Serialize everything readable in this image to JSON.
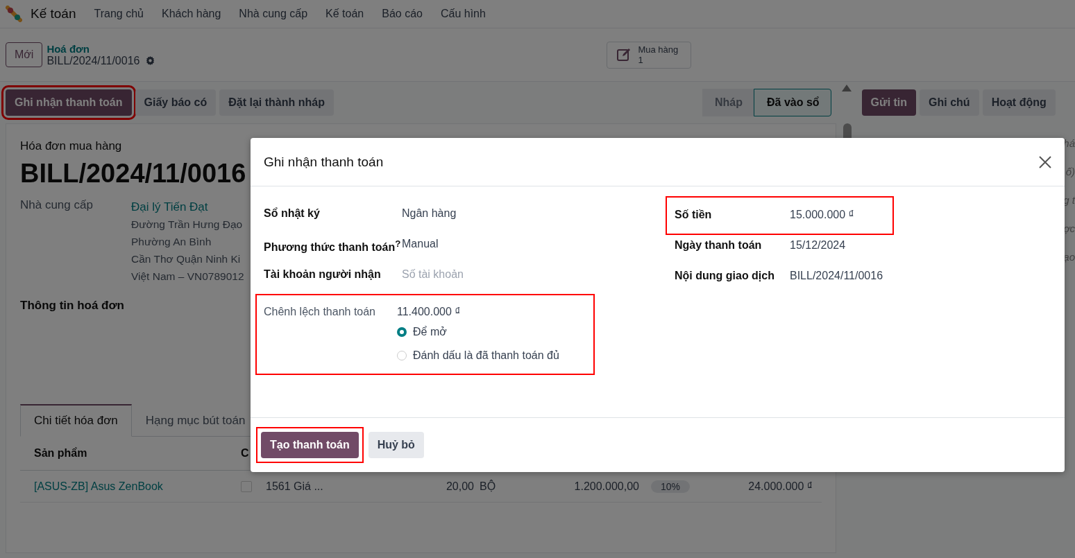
{
  "app": {
    "name": "Kế toán",
    "menu": [
      "Trang chủ",
      "Khách hàng",
      "Nhà cung cấp",
      "Kế toán",
      "Báo cáo",
      "Cấu hình"
    ]
  },
  "breadcrumb": {
    "new_button": "Mới",
    "parent": "Hoá đơn",
    "current": "BILL/2024/11/0016"
  },
  "smart_button": {
    "label": "Mua hàng",
    "count": "1"
  },
  "actions": [
    {
      "label": "Ghi nhận thanh toán",
      "primary": true,
      "highlighted": true
    },
    {
      "label": "Giấy báo có",
      "primary": false,
      "highlighted": false
    },
    {
      "label": "Đặt lại thành nháp",
      "primary": false,
      "highlighted": false
    }
  ],
  "statusbar": [
    {
      "label": "Nháp",
      "selected": false
    },
    {
      "label": "Đã vào sổ",
      "selected": true
    }
  ],
  "chatter": {
    "buttons": [
      {
        "label": "Gửi tin",
        "primary": true
      },
      {
        "label": "Ghi chú",
        "primary": false
      },
      {
        "label": "Hoạt động",
        "primary": false
      }
    ],
    "fragments": [
      "há",
      "ố)",
      "g t",
      "ợc",
      "ạo"
    ]
  },
  "form": {
    "subtitle": "Hóa đơn mua hàng",
    "title": "BILL/2024/11/0016",
    "vendor_label": "Nhà cung cấp",
    "vendor": "Đại lý Tiến Đạt",
    "address": [
      "Đường Trần Hưng Đạo",
      "Phường An Bình",
      "Cần Thơ Quận Ninh Ki",
      "Việt Nam – VN0789012"
    ],
    "section": "Thông tin hoá đơn",
    "tabs": [
      {
        "label": "Chi tiết hóa đơn",
        "selected": true
      },
      {
        "label": "Hạng mục bút toán",
        "selected": false
      }
    ],
    "table": {
      "columns": [
        "Sản phẩm",
        "C"
      ],
      "rows": [
        {
          "product": "[ASUS-ZB] Asus ZenBook",
          "checked": false,
          "account": "1561 Giá ...",
          "quantity": "20,00",
          "uom": "BỘ",
          "price": "1.200.000,00",
          "tax": "10%",
          "subtotal": "24.000.000 ₫"
        }
      ]
    }
  },
  "dialog": {
    "title": "Ghi nhận thanh toán",
    "left": [
      {
        "kind": "text",
        "label": "Sổ nhật ký",
        "value": "Ngân hàng"
      },
      {
        "kind": "text",
        "label": "Phương thức thanh toán$^{?}$",
        "value": "Manual"
      },
      {
        "kind": "input",
        "label": "Tài khoản người nhận",
        "placeholder": "Số tài khoản"
      }
    ],
    "difference": {
      "label": "Chênh lệch thanh toán",
      "value": "11.400.000 ₫",
      "highlighted": true,
      "options": [
        {
          "label": "Để mở",
          "selected": true
        },
        {
          "label": "Đánh dấu là đã thanh toán đủ",
          "selected": false
        }
      ]
    },
    "right": [
      {
        "label": "Số tiền",
        "value": "15.000.000 ₫",
        "highlighted": true
      },
      {
        "label": "Ngày thanh toán",
        "value": "15/12/2024",
        "highlighted": false
      },
      {
        "label": "Nội dung giao dịch",
        "value": "BILL/2024/11/0016",
        "highlighted": false
      }
    ],
    "buttons": [
      {
        "label": "Tạo thanh toán",
        "primary": true,
        "highlighted": true
      },
      {
        "label": "Huỷ bỏ",
        "primary": false,
        "highlighted": false
      }
    ]
  }
}
